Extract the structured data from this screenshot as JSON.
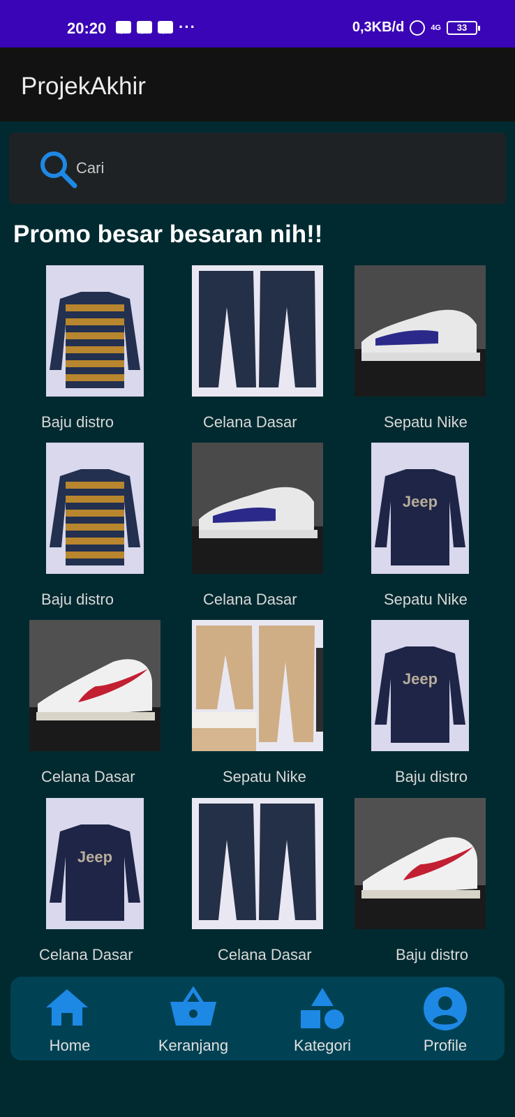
{
  "status_bar": {
    "time": "20:20",
    "network_speed": "0,3KB/d",
    "network_type": "4G",
    "battery": "33"
  },
  "app_bar": {
    "title": "ProjekAkhir"
  },
  "search": {
    "placeholder": "Cari",
    "icon": "search-icon"
  },
  "promo": {
    "title": "Promo besar besaran nih!!"
  },
  "products": [
    {
      "name": "Baju distro",
      "image": "striped-sweater"
    },
    {
      "name": "Celana Dasar",
      "image": "navy-pants"
    },
    {
      "name": "Sepatu Nike",
      "image": "sneaker-blue"
    },
    {
      "name": "Baju distro",
      "image": "striped-sweater"
    },
    {
      "name": "Celana Dasar",
      "image": "sneaker-blue"
    },
    {
      "name": "Sepatu Nike",
      "image": "jeep-sweater"
    },
    {
      "name": "Celana Dasar",
      "image": "nike-sneaker-white"
    },
    {
      "name": "Sepatu Nike",
      "image": "khaki-pants"
    },
    {
      "name": "Baju distro",
      "image": "jeep-sweater"
    },
    {
      "name": "Celana Dasar",
      "image": "jeep-sweater"
    },
    {
      "name": "Celana Dasar",
      "image": "navy-pants"
    },
    {
      "name": "Baju distro",
      "image": "nike-sneaker-white"
    }
  ],
  "bottom_nav": [
    {
      "label": "Home",
      "icon": "home-icon"
    },
    {
      "label": "Keranjang",
      "icon": "basket-icon"
    },
    {
      "label": "Kategori",
      "icon": "category-icon"
    },
    {
      "label": "Profile",
      "icon": "profile-icon"
    }
  ],
  "colors": {
    "status_bar": "#3a05b6",
    "app_bar": "#121212",
    "background": "#012a30",
    "accent": "#1e88e5",
    "nav_background": "#004254"
  }
}
